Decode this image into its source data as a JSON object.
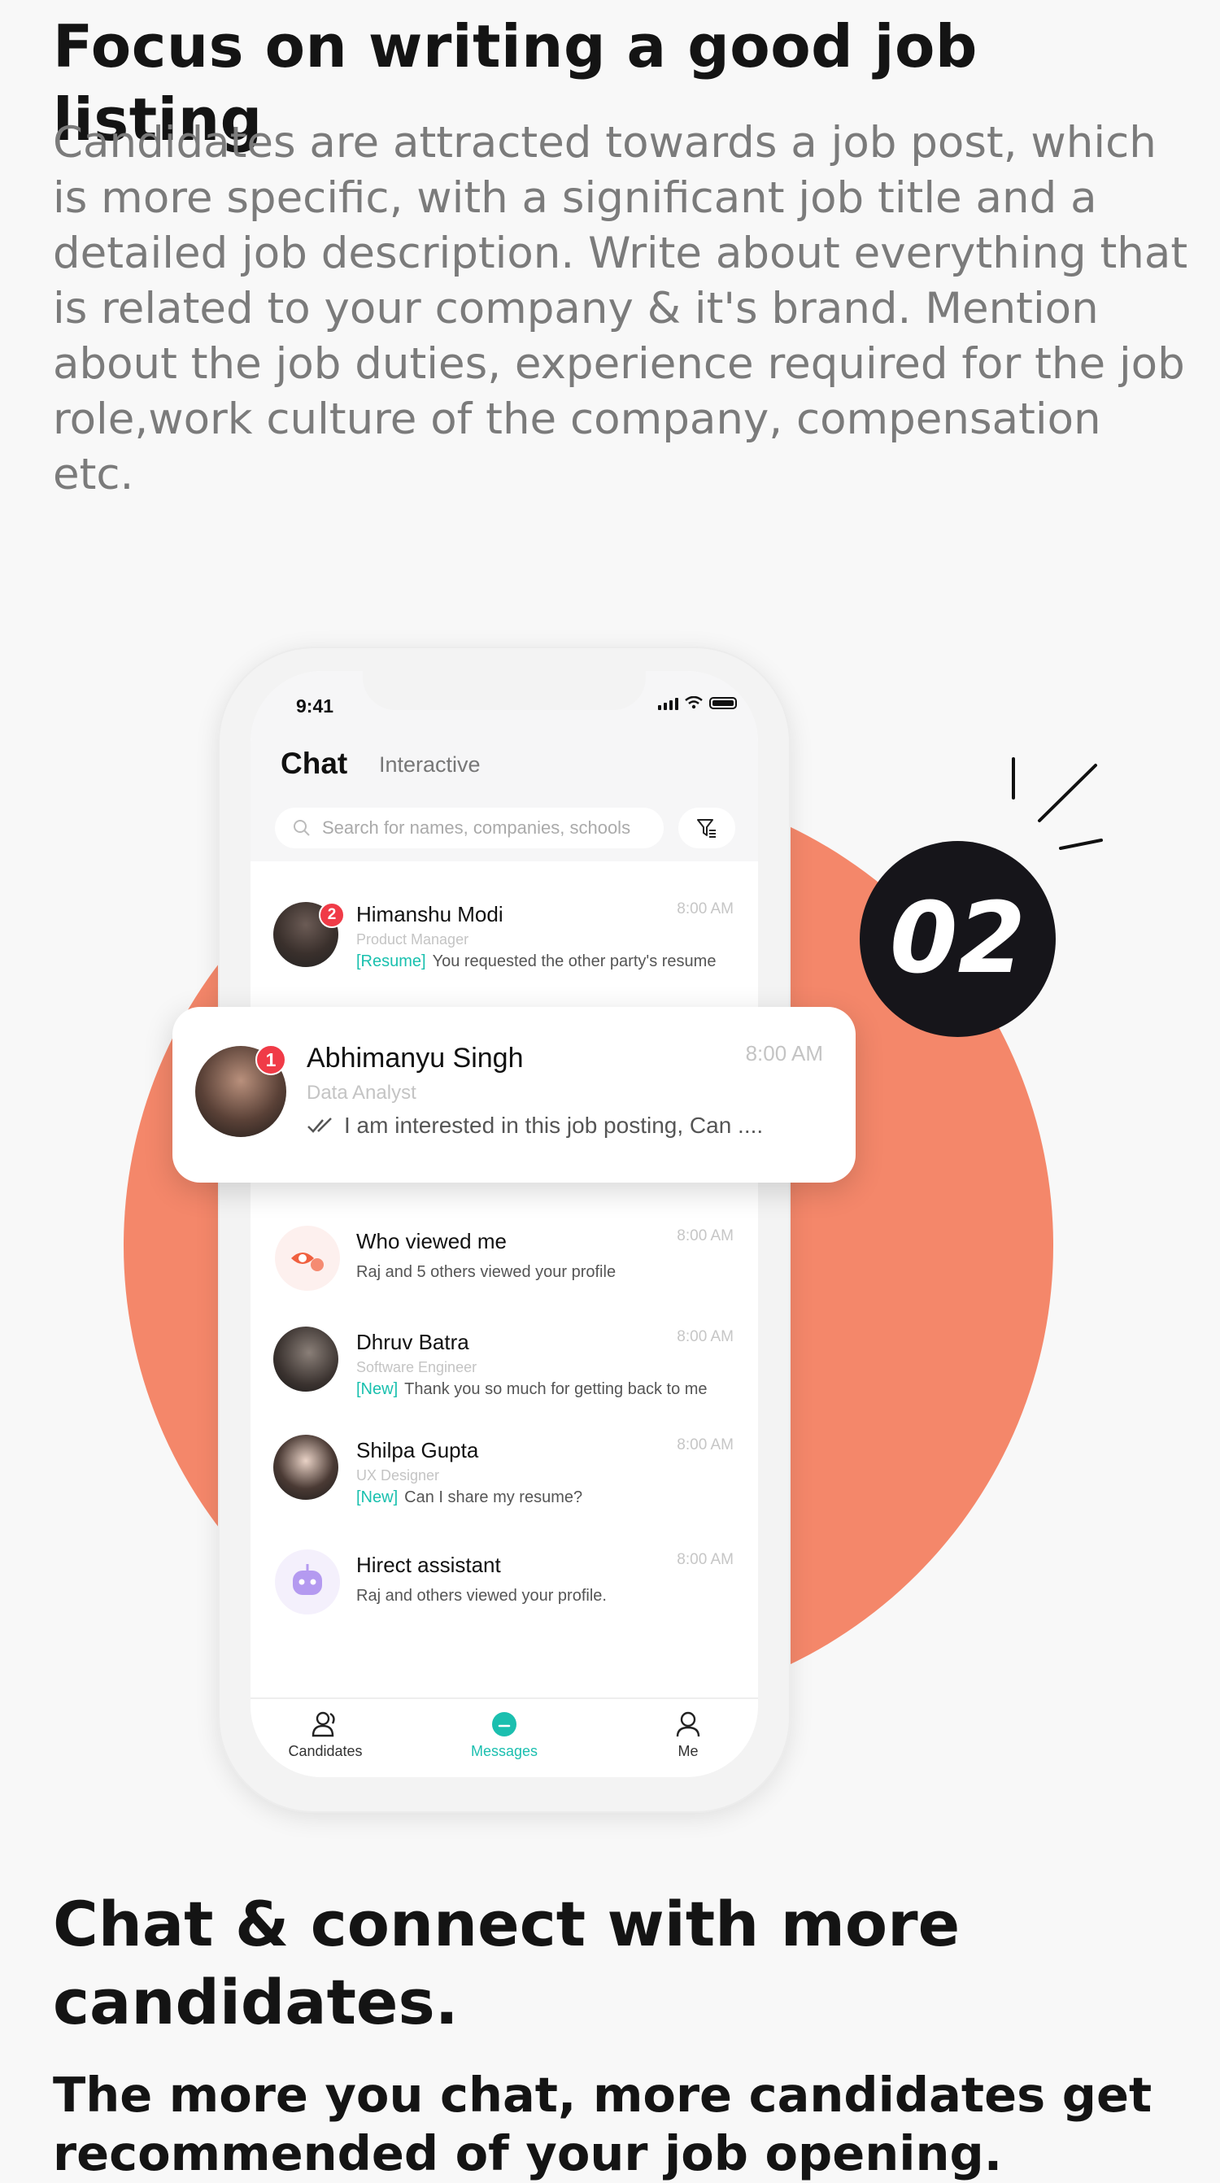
{
  "header": {
    "title": "Focus on writing a good job listing",
    "description": "Candidates are attracted towards a job post, which is more specific, with a significant job title and a detailed job description. Write about everything that is related to your company & it's brand. Mention about the job duties, experience required for the job role,work culture of the company, compensation etc."
  },
  "step_badge": "02",
  "phone": {
    "status_time": "9:41",
    "tabs": {
      "chat": "Chat",
      "interactive": "Interactive"
    },
    "search_placeholder": "Search for names, companies, schools",
    "conversations": [
      {
        "name": "Himanshu Modi",
        "role": "Product Manager",
        "tag": "[Resume]",
        "message": "You requested the other party's resume",
        "time": "8:00 AM",
        "unread": "2"
      },
      {
        "name": "Who viewed me",
        "message": "Raj and 5 others viewed your profile",
        "time": "8:00 AM"
      },
      {
        "name": "Dhruv Batra",
        "role": "Software Engineer",
        "tag": "[New]",
        "message": "Thank you so much for getting back to me",
        "time": "8:00 AM"
      },
      {
        "name": "Shilpa Gupta",
        "role": "UX Designer",
        "tag": "[New]",
        "message": "Can I share my resume?",
        "time": "8:00 AM"
      },
      {
        "name": "Hirect assistant",
        "message": "Raj and others viewed your profile.",
        "time": "8:00 AM"
      }
    ],
    "highlighted": {
      "name": "Abhimanyu Singh",
      "role": "Data Analyst",
      "message": "I am interested in this job posting, Can ....",
      "time": "8:00 AM",
      "unread": "1"
    },
    "tabbar": [
      {
        "label": "Candidates",
        "icon": "candidates-icon"
      },
      {
        "label": "Messages",
        "icon": "messages-icon",
        "active": true
      },
      {
        "label": "Me",
        "icon": "person-icon"
      }
    ]
  },
  "footer": {
    "title": "Chat & connect with more candidates.",
    "subtitle": "The more you chat, more candidates get recommended of your job opening."
  },
  "colors": {
    "accent": "#1bbfaf",
    "orange": "#f4876a",
    "badge_red": "#f03b47",
    "dark": "#16151a"
  }
}
